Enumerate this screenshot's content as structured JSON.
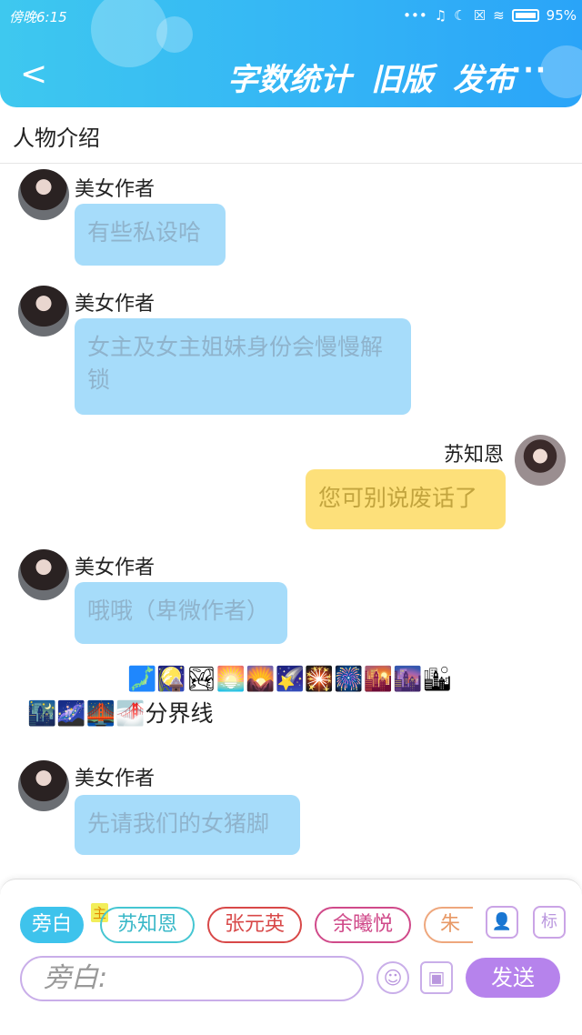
{
  "status": {
    "time": "傍晚6:15",
    "battery": "95%"
  },
  "header": {
    "back": "<",
    "actions": [
      "字数统计",
      "旧版",
      "发布"
    ],
    "more": "···"
  },
  "intro": {
    "label": "人物介绍"
  },
  "messages": [
    {
      "speaker": "美女作者",
      "text": "有些私设哈"
    },
    {
      "speaker": "美女作者",
      "text": "女主及女主姐妹身份会慢慢解锁"
    },
    {
      "speaker": "苏知恩",
      "text": "您可别说废话了"
    },
    {
      "speaker": "美女作者",
      "text": "哦哦（卑微作者）"
    },
    {
      "divider_emojis_1": "🗾🎑🏞🌅🌄🌠🎇🎆🌇🌆🏙",
      "divider_emojis_2": "🌃🌌🌉🌁",
      "divider_text": "分界线"
    },
    {
      "speaker": "美女作者",
      "text": "先请我们的女猪脚"
    }
  ],
  "composer": {
    "chips": [
      "旁白",
      "苏知恩",
      "张元英",
      "余曦悦",
      "朱玥"
    ],
    "tag_zhu": "主",
    "btn_person": "👤",
    "btn_tag": "标",
    "input_placeholder": "旁白:",
    "emoji_btn": "☺",
    "image_btn": "▣",
    "send": "发送"
  },
  "colors": {
    "accent": "#3ec3ec",
    "send": "#b683ec",
    "bubble_blue": "#a6dcfa",
    "bubble_yellow": "#fde07a"
  }
}
